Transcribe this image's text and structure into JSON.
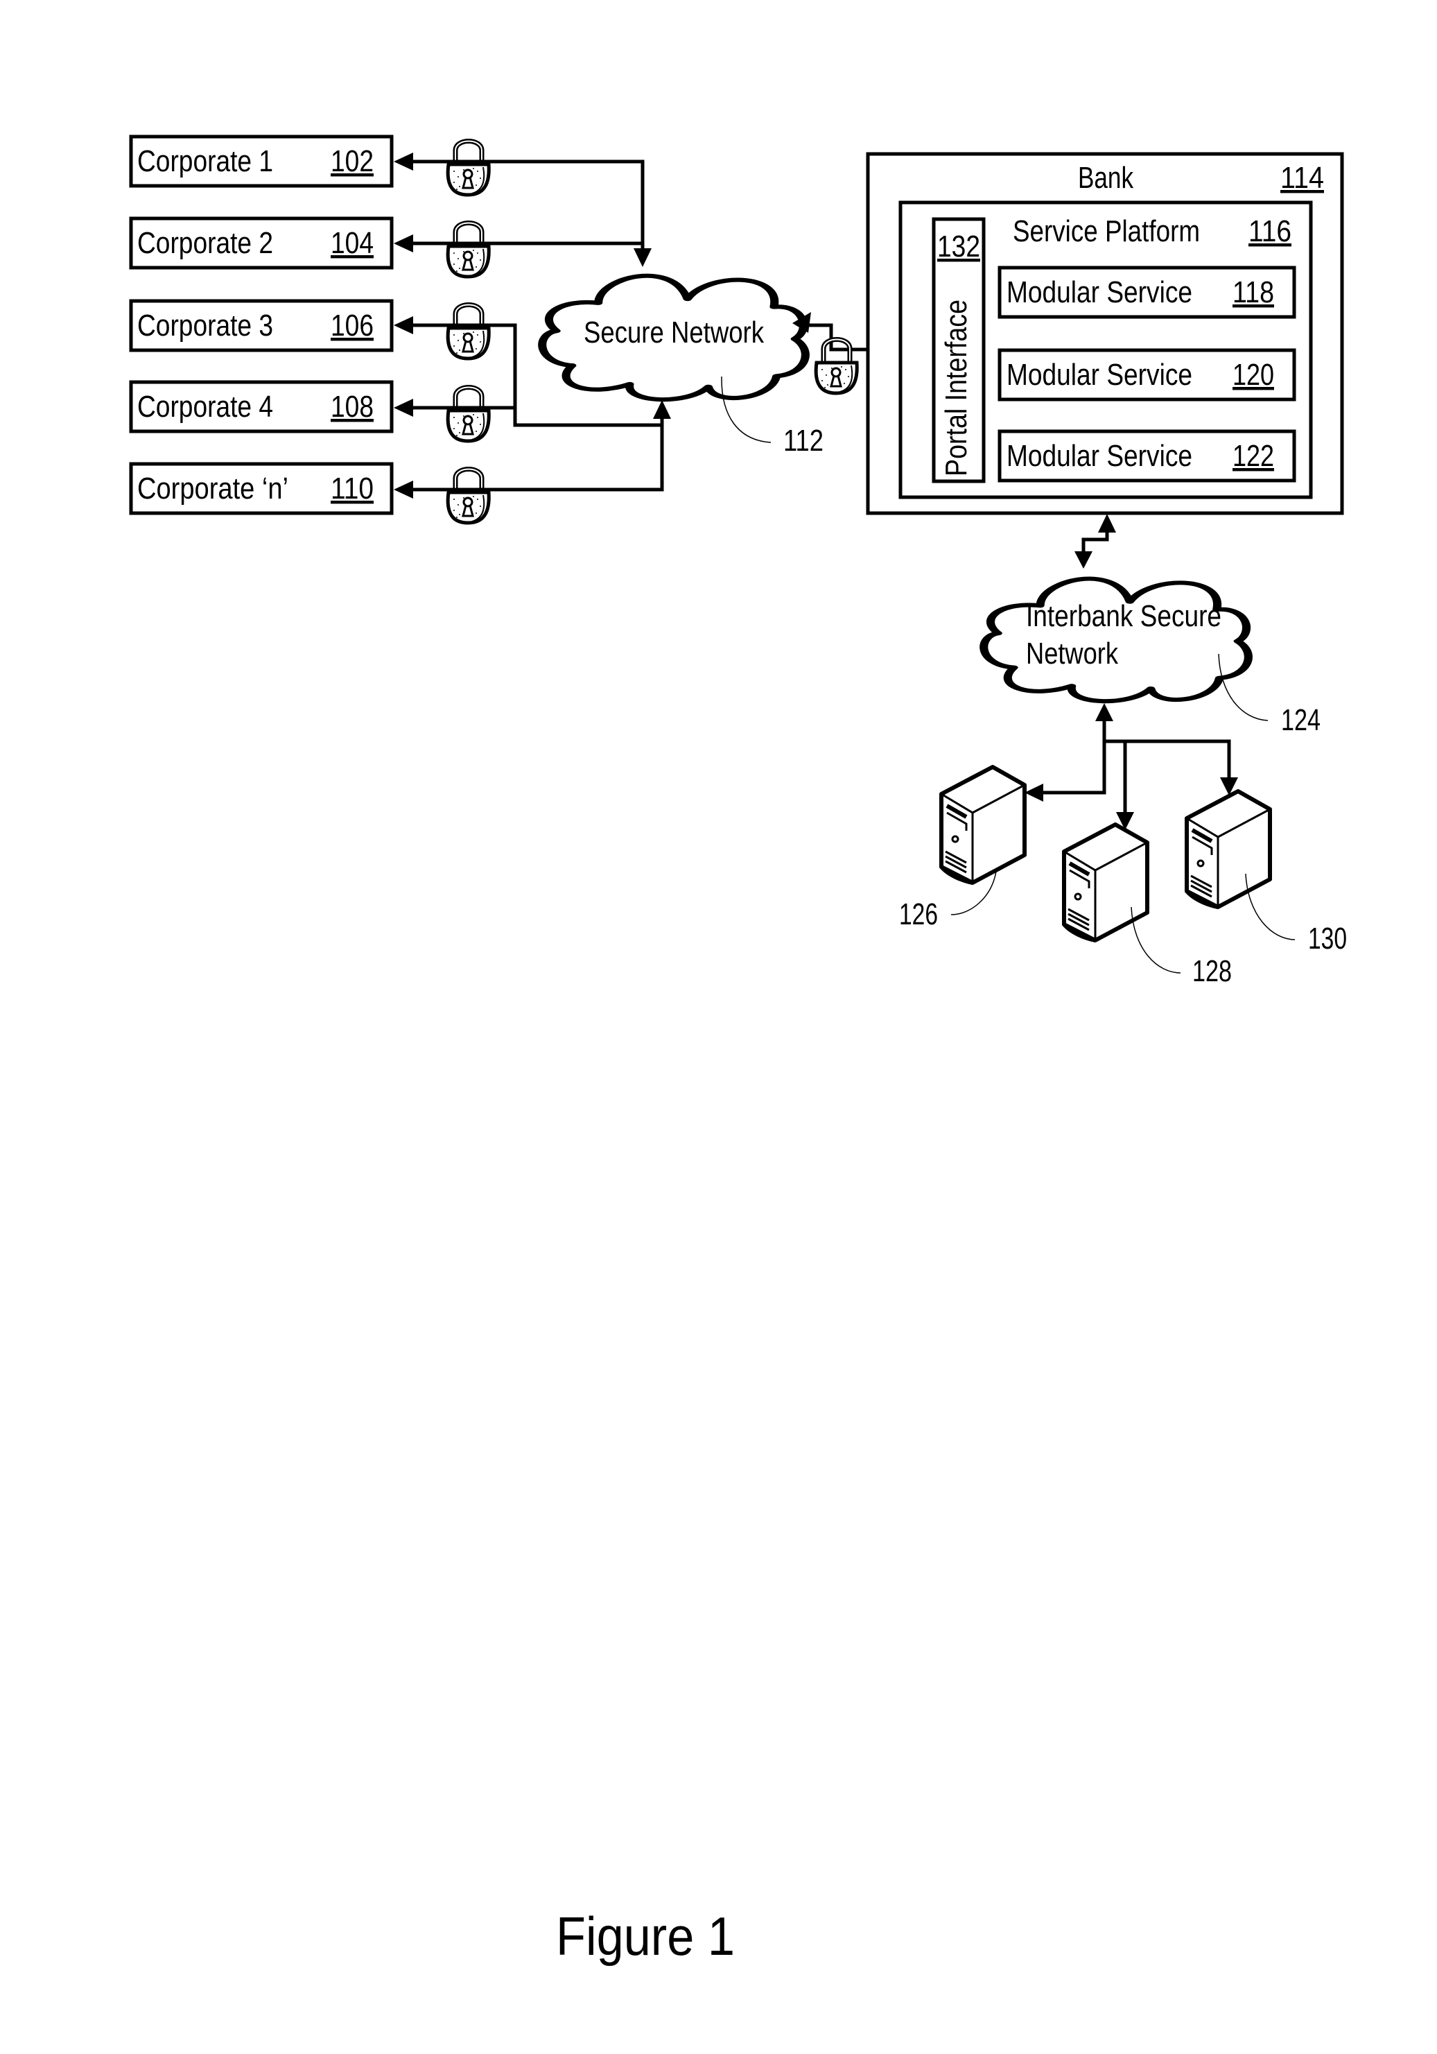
{
  "figure": {
    "caption": "Figure 1",
    "corporates": [
      {
        "label": "Corporate 1",
        "ref": "102"
      },
      {
        "label": "Corporate 2",
        "ref": "104"
      },
      {
        "label": "Corporate 3",
        "ref": "106"
      },
      {
        "label": "Corporate 4",
        "ref": "108"
      },
      {
        "label": "Corporate ‘n’",
        "ref": "110"
      }
    ],
    "secure_network": {
      "label": "Secure Network",
      "ref": "112"
    },
    "bank": {
      "label": "Bank",
      "ref": "114",
      "service_platform": {
        "label": "Service Platform",
        "ref": "116",
        "portal_interface": {
          "label": "Portal Interface",
          "ref": "132"
        },
        "modular_services": [
          {
            "label": "Modular Service",
            "ref": "118"
          },
          {
            "label": "Modular Service",
            "ref": "120"
          },
          {
            "label": "Modular Service",
            "ref": "122"
          }
        ]
      }
    },
    "interbank_network": {
      "label_line1": "Interbank Secure",
      "label_line2": "Network",
      "ref": "124"
    },
    "servers": [
      {
        "ref": "126",
        "icon": "server-icon"
      },
      {
        "ref": "128",
        "icon": "server-icon"
      },
      {
        "ref": "130",
        "icon": "server-icon"
      }
    ],
    "icons": {
      "lock": "padlock-icon",
      "server": "server-icon",
      "cloud": "cloud-icon"
    }
  }
}
